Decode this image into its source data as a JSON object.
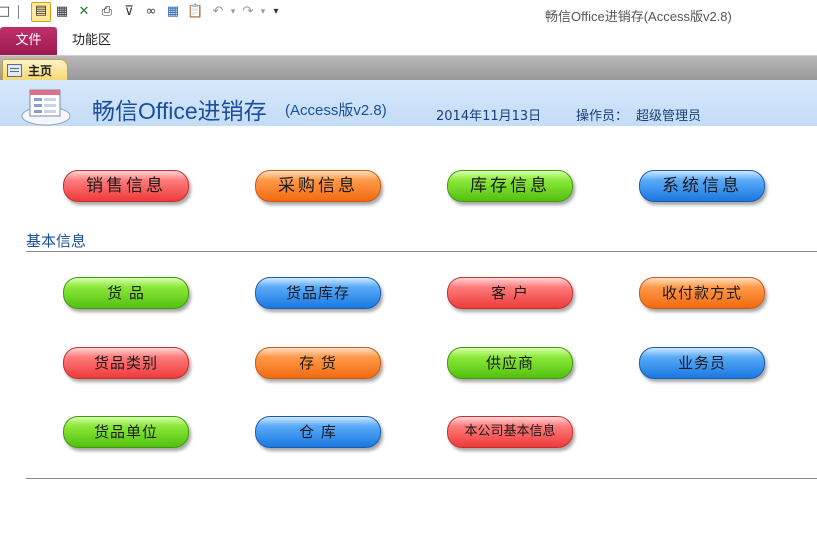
{
  "window": {
    "title": "畅信Office进销存(Access版v2.8)"
  },
  "ribbon": {
    "file_tab": "文件",
    "func_tab": "功能区"
  },
  "doc_tab": {
    "label": "主页"
  },
  "header": {
    "title": "畅信Office进销存",
    "subtitle": "(Access版v2.8)",
    "date": "2014年11月13日",
    "operator_label": "操作员：",
    "operator_name": "超级管理员"
  },
  "main_nav": {
    "sales": "销售信息",
    "purchase": "采购信息",
    "inventory": "库存信息",
    "system": "系统信息"
  },
  "basic_info": {
    "title": "基本信息",
    "goods": "货  品",
    "goods_stock": "货品库存",
    "customer": "客  户",
    "payment_method": "收付款方式",
    "goods_category": "货品类别",
    "stock": "存  货",
    "supplier": "供应商",
    "salesperson": "业务员",
    "goods_unit": "货品单位",
    "warehouse": "仓  库",
    "company_info": "本公司基本信息"
  },
  "colors": {
    "red": "#ee3a3a",
    "orange": "#f26a10",
    "green": "#52c010",
    "blue": "#1a78e0",
    "header_text": "#1a4f9c",
    "file_tab": "#9c1a50"
  },
  "icons": [
    "layout-icon",
    "form-view-icon",
    "table-view-icon",
    "excel-icon",
    "print-icon",
    "filter-icon",
    "binoculars-icon",
    "grid-icon",
    "paste-icon",
    "undo-icon",
    "redo-icon",
    "customize-icon"
  ]
}
